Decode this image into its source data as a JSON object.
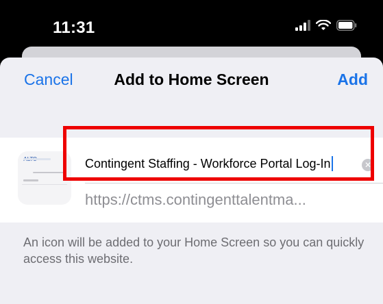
{
  "status_bar": {
    "time": "11:31",
    "icons": [
      "cellular-signal-icon",
      "wifi-icon",
      "battery-icon"
    ]
  },
  "nav": {
    "cancel_label": "Cancel",
    "title": "Add to Home Screen",
    "add_label": "Add"
  },
  "bookmark": {
    "thumbnail_logo_text": "ALTO",
    "name_value": "Contingent Staffing - Workforce Portal Log-In",
    "url": "https://ctms.contingenttalentma..."
  },
  "hint": "An icon will be added to your Home Screen so you can quickly access this website.",
  "colors": {
    "accent": "#1a73e8",
    "highlight": "#ee0000",
    "sheet_bg": "#efeff4"
  }
}
